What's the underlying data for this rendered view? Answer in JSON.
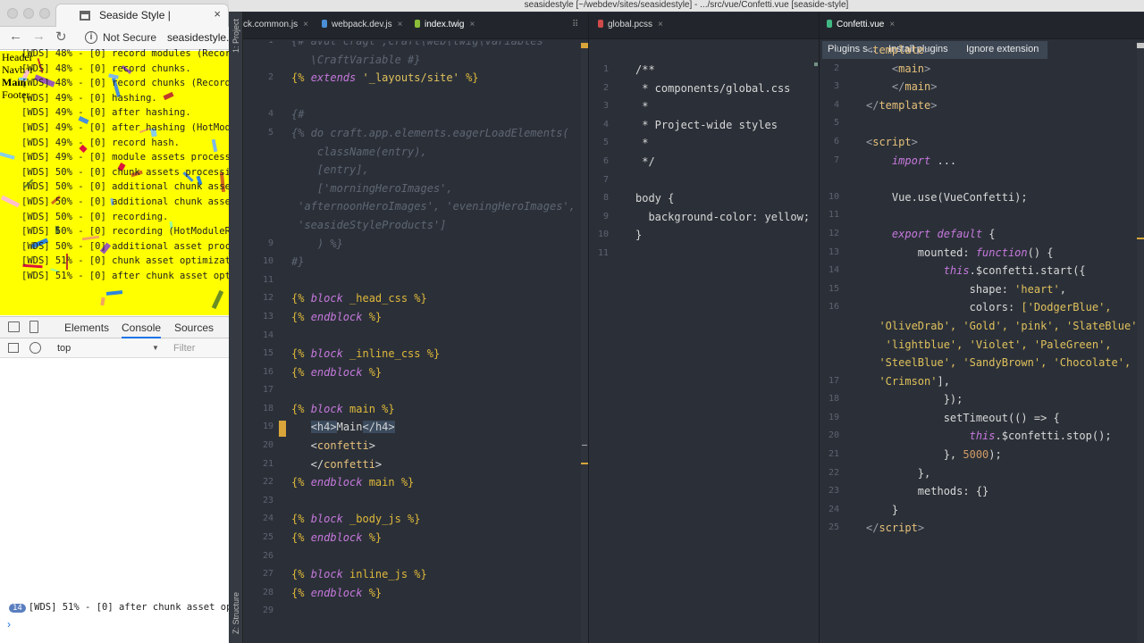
{
  "browser": {
    "tab_title": "Seaside Style |",
    "tab_close": "×",
    "back": "←",
    "forward": "→",
    "reload": "↻",
    "info_glyph": "i",
    "not_secure": "Not Secure",
    "url": "seasidestyle.",
    "viewport_lines": [
      "Header",
      "Navbar",
      "Main",
      "Footer."
    ],
    "background_color": "#ffff00"
  },
  "devtools": {
    "tabs": [
      "Elements",
      "Console",
      "Sources"
    ],
    "context": "top",
    "context_arrow": "▼",
    "filter_placeholder": "Filter",
    "console_lines": [
      "[WDS] 48% - [0] record modules (RecordIds",
      "[WDS] 48% - [0] record chunks.",
      "[WDS] 48% - [0] record chunks (RecordIds",
      "[WDS] 49% - [0] hashing.",
      "[WDS] 49% - [0] after hashing.",
      "[WDS] 49% - [0] after hashing (HotModule",
      "[WDS] 49% - [0] record hash.",
      "[WDS] 49% - [0] module assets processing.",
      "[WDS] 50% - [0] chunk assets processing.",
      "[WDS] 50% - [0] additional chunk assets p",
      "[WDS] 50% - [0] additional chunk assets p",
      "[WDS] 50% - [0] recording.",
      "[WDS] 50% - [0] recording (HotModuleRepl",
      "[WDS] 50% - [0] additional asset process",
      "[WDS] 51% - [0] chunk asset optimization.",
      "[WDS] 51% - [0] after chunk asset optimi"
    ],
    "badge_count": "14",
    "last_line": "[WDS] 51% - [0] after chunk asset optin",
    "prompt": "›"
  },
  "ide": {
    "title": "seasidestyle [~/webdev/sites/seasidestyle] - .../src/vue/Confetti.vue [seaside-style]",
    "strip_top": "1: Project",
    "strip_bottom": "Z: Structure",
    "tabs": {
      "common": "ck.common.js",
      "webpack_dev": "webpack.dev.js",
      "index_twig": "index.twig",
      "global_pcss": "global.pcss",
      "confetti_vue": "Confetti.vue",
      "close": "×",
      "overflow": "⠿"
    },
    "plugin_bar": {
      "title": "Plugins s...",
      "install": "Install plugins",
      "ignore": "Ignore extension"
    },
    "twig_nums": [
      "1",
      "",
      "2",
      "",
      "4",
      "5",
      "",
      "",
      "",
      "",
      "",
      "9",
      "10",
      "11",
      "12",
      "13",
      "14",
      "15",
      "16",
      "17",
      "18",
      "19",
      "20",
      "21",
      "22",
      "23",
      "24",
      "25",
      "26",
      "27",
      "28",
      "29"
    ],
    "pcss_nums": [
      "1",
      "2",
      "3",
      "4",
      "5",
      "6",
      "7",
      "8",
      "9",
      "10",
      "11"
    ],
    "vue_nums": [
      "1",
      "2",
      "3",
      "4",
      "5",
      "6",
      "7",
      "",
      "10",
      "11",
      "12",
      "13",
      "14",
      "15",
      "16",
      "",
      "",
      "",
      "17",
      "18",
      "19",
      "20",
      "21",
      "22",
      "23",
      "24",
      "25"
    ],
    "twig_lines": [
      [
        [
          "sp-cm",
          "{# avut cragt ;craft\\web\\twig\\variables"
        ]
      ],
      [
        [
          "sp-cm",
          "   \\CraftVariable #}"
        ]
      ],
      [
        [
          "sp-twig",
          "{% "
        ],
        [
          "sp-kw",
          "extends"
        ],
        [
          "sp-str",
          " '_layouts/site'"
        ],
        [
          "sp-twig",
          " %}"
        ]
      ],
      [],
      [
        [
          "sp-cm",
          "{#"
        ]
      ],
      [
        [
          "sp-cm",
          "{% do craft.app.elements.eagerLoadElements("
        ]
      ],
      [
        [
          "sp-cm",
          "    className(entry),"
        ]
      ],
      [
        [
          "sp-cm",
          "    [entry],"
        ]
      ],
      [
        [
          "sp-cm",
          "    ['morningHeroImages',"
        ]
      ],
      [
        [
          "sp-cm",
          " 'afternoonHeroImages', 'eveningHeroImages',"
        ]
      ],
      [
        [
          "sp-cm",
          " 'seasideStyleProducts']"
        ]
      ],
      [
        [
          "sp-cm",
          "    ) %}"
        ]
      ],
      [
        [
          "sp-cm",
          "#}"
        ]
      ],
      [],
      [
        [
          "sp-twig",
          "{% "
        ],
        [
          "sp-kw",
          "block"
        ],
        [
          "sp-twig",
          " _head_css %}"
        ]
      ],
      [
        [
          "sp-twig",
          "{% "
        ],
        [
          "sp-kw",
          "endblock"
        ],
        [
          "sp-twig",
          " %}"
        ]
      ],
      [],
      [
        [
          "sp-twig",
          "{% "
        ],
        [
          "sp-kw",
          "block"
        ],
        [
          "sp-twig",
          " _inline_css %}"
        ]
      ],
      [
        [
          "sp-twig",
          "{% "
        ],
        [
          "sp-kw",
          "endblock"
        ],
        [
          "sp-twig",
          " %}"
        ]
      ],
      [],
      [
        [
          "sp-twig",
          "{% "
        ],
        [
          "sp-kw",
          "block"
        ],
        [
          "sp-twig",
          " main %}"
        ]
      ],
      [
        [
          "sp-plain",
          "   "
        ],
        [
          "sp-hl",
          "<h4>"
        ],
        [
          "sp-plain",
          "Main"
        ],
        [
          "sp-hl",
          "</h4>"
        ]
      ],
      [
        [
          "sp-plain",
          "   <"
        ],
        [
          "sp-tag",
          "confetti"
        ],
        [
          "sp-plain",
          ">"
        ]
      ],
      [
        [
          "sp-plain",
          "   </"
        ],
        [
          "sp-tag",
          "confetti"
        ],
        [
          "sp-plain",
          ">"
        ]
      ],
      [
        [
          "sp-twig",
          "{% "
        ],
        [
          "sp-kw",
          "endblock"
        ],
        [
          "sp-twig",
          " main %}"
        ]
      ],
      [],
      [
        [
          "sp-twig",
          "{% "
        ],
        [
          "sp-kw",
          "block"
        ],
        [
          "sp-twig",
          " _body_js %}"
        ]
      ],
      [
        [
          "sp-twig",
          "{% "
        ],
        [
          "sp-kw",
          "endblock"
        ],
        [
          "sp-twig",
          " %}"
        ]
      ],
      [],
      [
        [
          "sp-twig",
          "{% "
        ],
        [
          "sp-kw",
          "block"
        ],
        [
          "sp-twig",
          " inline_js %}"
        ]
      ],
      [
        [
          "sp-twig",
          "{% "
        ],
        [
          "sp-kw",
          "endblock"
        ],
        [
          "sp-twig",
          " %}"
        ]
      ],
      []
    ],
    "pcss_lines": [
      [
        [
          "sp-plain",
          "/**"
        ]
      ],
      [
        [
          "sp-plain",
          " * components/global.css"
        ]
      ],
      [
        [
          "sp-plain",
          " *"
        ]
      ],
      [
        [
          "sp-plain",
          " * Project-wide styles"
        ]
      ],
      [
        [
          "sp-plain",
          " *"
        ]
      ],
      [
        [
          "sp-plain",
          " */"
        ]
      ],
      [],
      [
        [
          "sp-plain",
          "body {"
        ]
      ],
      [
        [
          "sp-plain",
          "  background-color: yellow;"
        ]
      ],
      [
        [
          "sp-plain",
          "}"
        ]
      ],
      []
    ],
    "vue_lines": [
      [
        [
          "sp-lt",
          "<"
        ],
        [
          "sp-tag",
          "template"
        ],
        [
          "sp-lt",
          ">"
        ]
      ],
      [
        [
          "sp-lt",
          "    <"
        ],
        [
          "sp-tag",
          "main"
        ],
        [
          "sp-lt",
          ">"
        ]
      ],
      [
        [
          "sp-lt",
          "    </"
        ],
        [
          "sp-tag",
          "main"
        ],
        [
          "sp-lt",
          ">"
        ]
      ],
      [
        [
          "sp-lt",
          "</"
        ],
        [
          "sp-tag",
          "template"
        ],
        [
          "sp-lt",
          ">"
        ]
      ],
      [],
      [
        [
          "sp-lt",
          "<"
        ],
        [
          "sp-tag",
          "script"
        ],
        [
          "sp-lt",
          ">"
        ]
      ],
      [
        [
          "sp-kw",
          "    import"
        ],
        [
          "sp-plain",
          " ..."
        ]
      ],
      [],
      [
        [
          "sp-plain",
          "    Vue.use(VueConfetti);"
        ]
      ],
      [],
      [
        [
          "sp-kw",
          "    export default"
        ],
        [
          "sp-plain",
          " {"
        ]
      ],
      [
        [
          "sp-plain",
          "        mounted: "
        ],
        [
          "sp-kw",
          "function"
        ],
        [
          "sp-plain",
          "() {"
        ]
      ],
      [
        [
          "sp-this",
          "            this"
        ],
        [
          "sp-plain",
          ".$confetti.start({"
        ]
      ],
      [
        [
          "sp-plain",
          "                shape: "
        ],
        [
          "sp-str",
          "'heart'"
        ],
        [
          "sp-plain",
          ","
        ]
      ],
      [
        [
          "sp-plain",
          "                colors: "
        ],
        [
          "sp-str",
          "['DodgerBlue',"
        ]
      ],
      [
        [
          "sp-str",
          "  'OliveDrab', 'Gold', 'pink', 'SlateBlue',"
        ]
      ],
      [
        [
          "sp-str",
          "   'lightblue', 'Violet', 'PaleGreen',"
        ]
      ],
      [
        [
          "sp-str",
          "  'SteelBlue', 'SandyBrown', 'Chocolate',"
        ]
      ],
      [
        [
          "sp-str",
          "  'Crimson'"
        ],
        [
          "sp-plain",
          "],"
        ]
      ],
      [
        [
          "sp-plain",
          "            });"
        ]
      ],
      [
        [
          "sp-plain",
          "            setTimeout(() => {"
        ]
      ],
      [
        [
          "sp-this",
          "                this"
        ],
        [
          "sp-plain",
          ".$confetti.stop();"
        ]
      ],
      [
        [
          "sp-plain",
          "            }, "
        ],
        [
          "sp-num",
          "5000"
        ],
        [
          "sp-plain",
          ");"
        ]
      ],
      [
        [
          "sp-plain",
          "        },"
        ]
      ],
      [
        [
          "sp-plain",
          "        methods: {}"
        ]
      ],
      [
        [
          "sp-plain",
          "    }"
        ]
      ],
      [
        [
          "sp-lt",
          "</"
        ],
        [
          "sp-tag",
          "script"
        ],
        [
          "sp-lt",
          ">"
        ]
      ],
      []
    ]
  },
  "colors": {
    "ide_bg": "#2b3038",
    "twig_keyword": "#c678dd",
    "twig_delim": "#e0b93a",
    "string": "#e0c15c",
    "devtools_accent": "#1a73e8"
  }
}
